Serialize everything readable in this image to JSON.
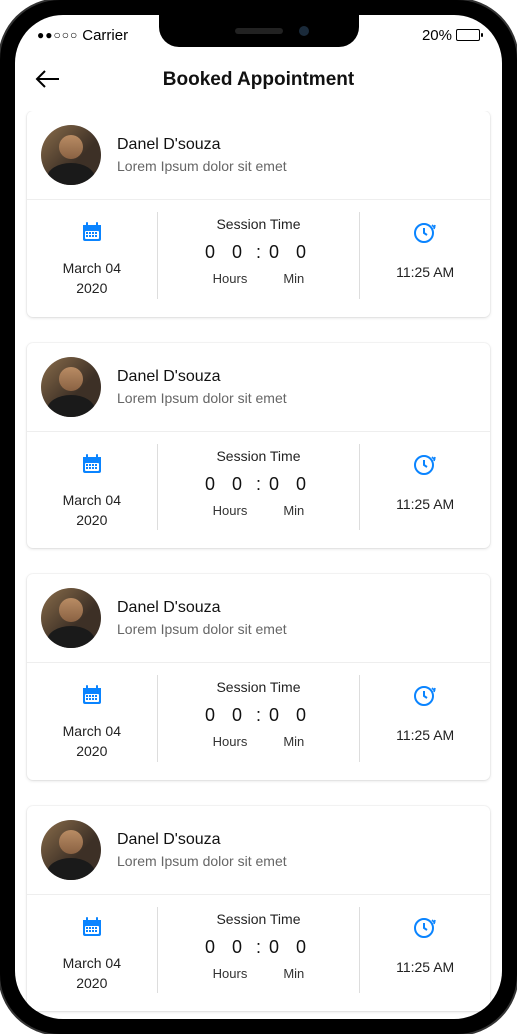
{
  "status": {
    "carrier": "Carrier",
    "battery_pct": "20%"
  },
  "header": {
    "title": "Booked  Appointment"
  },
  "session_labels": {
    "title": "Session Time",
    "hours": "Hours",
    "min": "Min"
  },
  "appointments": [
    {
      "name": "Danel D'souza",
      "subtitle": "Lorem Ipsum dolor sit emet",
      "date_line1": "March 04",
      "date_line2": "2020",
      "hh": "0 0",
      "mm": "0 0",
      "time": "11:25 AM"
    },
    {
      "name": "Danel D'souza",
      "subtitle": "Lorem Ipsum dolor sit emet",
      "date_line1": "March 04",
      "date_line2": "2020",
      "hh": "0 0",
      "mm": "0 0",
      "time": "11:25 AM"
    },
    {
      "name": "Danel D'souza",
      "subtitle": "Lorem Ipsum dolor sit emet",
      "date_line1": "March 04",
      "date_line2": "2020",
      "hh": "0 0",
      "mm": "0 0",
      "time": "11:25 AM"
    },
    {
      "name": "Danel D'souza",
      "subtitle": "Lorem Ipsum dolor sit emet",
      "date_line1": "March 04",
      "date_line2": "2020",
      "hh": "0 0",
      "mm": "0 0",
      "time": "11:25 AM"
    }
  ]
}
